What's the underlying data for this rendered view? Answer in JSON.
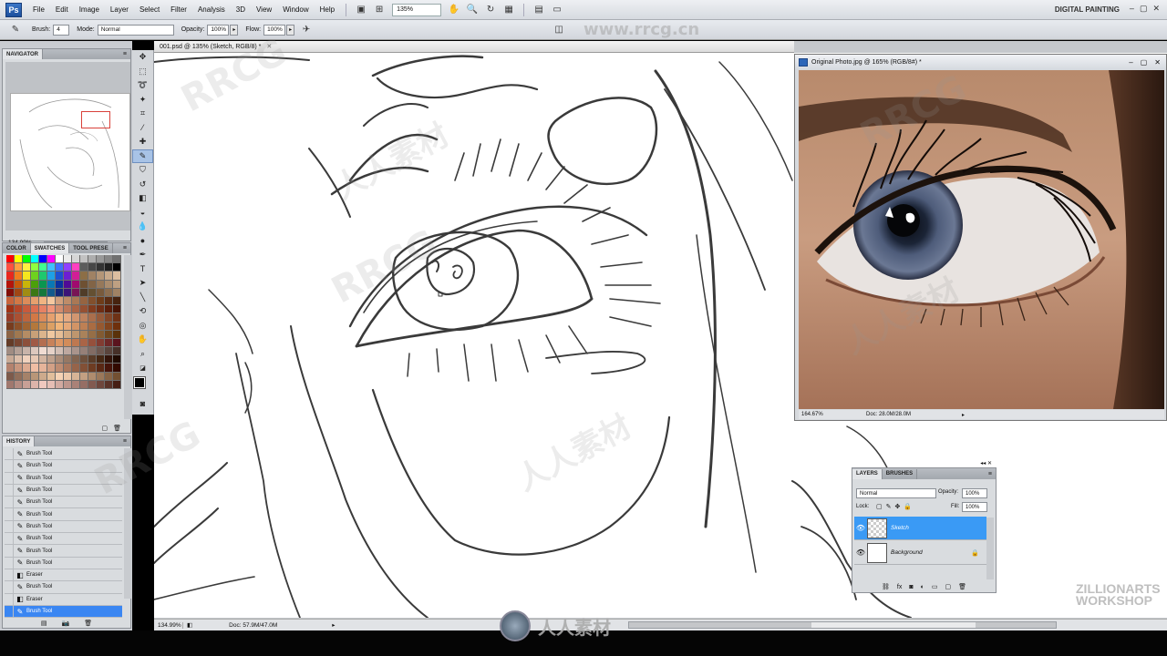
{
  "app": {
    "logo": "Ps",
    "menu": [
      "File",
      "Edit",
      "Image",
      "Layer",
      "Select",
      "Filter",
      "Analysis",
      "3D",
      "View",
      "Window",
      "Help"
    ],
    "zoom": "135%",
    "workspace": "DIGITAL PAINTING",
    "win_controls": [
      "–",
      "▢",
      "✕"
    ]
  },
  "options": {
    "brush_label": "Brush:",
    "brush_size": "4",
    "mode_label": "Mode:",
    "mode_value": "Normal",
    "opacity_label": "Opacity:",
    "opacity_value": "100%",
    "flow_label": "Flow:",
    "flow_value": "100%"
  },
  "document": {
    "tab_title": "001.psd @ 135% (Sketch, RGB/8) *",
    "status_zoom": "134.99%",
    "status_doc": "Doc: 57.9M/47.0M"
  },
  "navigator": {
    "title": "NAVIGATOR",
    "zoom": "134.99%"
  },
  "swatches": {
    "tabs": [
      "COLOR",
      "SWATCHES",
      "TOOL PRESE"
    ],
    "colors": [
      "#ff0000",
      "#ffff00",
      "#00ff00",
      "#00ffff",
      "#0000ff",
      "#ff00ff",
      "#ffffff",
      "#ebebeb",
      "#d6d6d6",
      "#c2c2c2",
      "#adadad",
      "#999999",
      "#858585",
      "#707070",
      "#ff5040",
      "#ffa040",
      "#fff040",
      "#90ff40",
      "#40ff90",
      "#40c0ff",
      "#4070ff",
      "#9040ff",
      "#ff40c0",
      "#5c5c5c",
      "#474747",
      "#333333",
      "#1f1f1f",
      "#000000",
      "#e8281e",
      "#f07d1e",
      "#f5e61e",
      "#6ed21e",
      "#1ec86e",
      "#1ea0e6",
      "#1e50d2",
      "#6e1ed2",
      "#d21e96",
      "#8c6e46",
      "#a08264",
      "#b49678",
      "#c8aa8c",
      "#dcbea0",
      "#b4140a",
      "#c85a0a",
      "#c8b40a",
      "#4ba00a",
      "#0a9650",
      "#0a78b4",
      "#0a32a0",
      "#500a96",
      "#a00a6e",
      "#6e5032",
      "#826446",
      "#96785a",
      "#aa8c6e",
      "#bea082",
      "#82100a",
      "#a04614",
      "#a08c14",
      "#3c7814",
      "#14783c",
      "#145a8c",
      "#142878",
      "#3c1478",
      "#781455",
      "#503c28",
      "#645032",
      "#785a3c",
      "#8c6e50",
      "#a08264",
      "#c8643c",
      "#d27846",
      "#dc8c5a",
      "#e6a06e",
      "#f0b482",
      "#f5c8a0",
      "#d2a07d",
      "#be8c69",
      "#aa7855",
      "#966441",
      "#82502d",
      "#6e3c19",
      "#5a2d14",
      "#46230f",
      "#a03214",
      "#b44628",
      "#c85a3c",
      "#dc6e50",
      "#e68264",
      "#f09678",
      "#d28c6e",
      "#be785a",
      "#aa6446",
      "#965032",
      "#823c1e",
      "#6e2d14",
      "#5a1e0a",
      "#461405",
      "#963c28",
      "#aa5032",
      "#be643c",
      "#d27846",
      "#dc8c5a",
      "#e6a06e",
      "#f0b482",
      "#e6aa82",
      "#d29670",
      "#be825e",
      "#aa6e4c",
      "#965a3a",
      "#824628",
      "#6e3216",
      "#783c1e",
      "#8c5028",
      "#a06432",
      "#b4783c",
      "#c88c50",
      "#dca064",
      "#f0b478",
      "#e6a878",
      "#d29466",
      "#be8054",
      "#aa6c42",
      "#965830",
      "#82441e",
      "#6e300c",
      "#8c6446",
      "#a07850",
      "#b48c64",
      "#c8a078",
      "#dcb48c",
      "#f0c8a0",
      "#e6be96",
      "#d2aa82",
      "#be966e",
      "#aa825a",
      "#966e46",
      "#825a32",
      "#6e461e",
      "#5a320a",
      "#643c28",
      "#784632",
      "#8c503c",
      "#a05a46",
      "#b46e50",
      "#c8825a",
      "#dc9664",
      "#d28c5a",
      "#be7850",
      "#aa6446",
      "#96503c",
      "#823c32",
      "#6e2828",
      "#5a141e",
      "#a08c82",
      "#b4a096",
      "#c8b4aa",
      "#dcc8be",
      "#f0dcd2",
      "#e6d2c8",
      "#d2beb4",
      "#bea8a0",
      "#aa948c",
      "#968078",
      "#826c64",
      "#6e5850",
      "#5a443c",
      "#463028",
      "#c8aa96",
      "#dcbeaa",
      "#f0d2be",
      "#e6c8b4",
      "#d2b4a0",
      "#bea08c",
      "#aa8c78",
      "#967864",
      "#826450",
      "#6e503c",
      "#5a3c28",
      "#462814",
      "#32140a",
      "#1e0a00",
      "#b4826e",
      "#c8967e",
      "#dcaa90",
      "#f0bea4",
      "#e6b49a",
      "#d2a086",
      "#be8c72",
      "#aa785e",
      "#96644a",
      "#825036",
      "#6e3c22",
      "#5a2814",
      "#46140a",
      "#320a00",
      "#7d5a4b",
      "#916e5a",
      "#a58269",
      "#b99678",
      "#cdaa8c",
      "#e1be9b",
      "#f5d2b4",
      "#ebc8aa",
      "#d7b496",
      "#c3a082",
      "#af8c6e",
      "#9b785a",
      "#876446",
      "#735032",
      "#a0786e",
      "#b48c82",
      "#c8a096",
      "#dcb4aa",
      "#f0c8be",
      "#e6beb4",
      "#d2aaa0",
      "#be968c",
      "#aa8278",
      "#966e64",
      "#825a50",
      "#6e463c",
      "#5a3228",
      "#461e14"
    ]
  },
  "history": {
    "title": "HISTORY",
    "items": [
      "Brush Tool",
      "Brush Tool",
      "Brush Tool",
      "Brush Tool",
      "Brush Tool",
      "Brush Tool",
      "Brush Tool",
      "Brush Tool",
      "Brush Tool",
      "Brush Tool",
      "Eraser",
      "Brush Tool",
      "Eraser",
      "Brush Tool"
    ]
  },
  "photo": {
    "title": "Original Photo.jpg @ 165% (RGB/8#) *",
    "zoom": "164.67%",
    "doc": "Doc: 28.0M/28.0M"
  },
  "layers": {
    "tabs": [
      "LAYERS",
      "BRUSHES"
    ],
    "blend": "Normal",
    "opacity_label": "Opacity:",
    "opacity": "100%",
    "lock_label": "Lock:",
    "fill_label": "Fill:",
    "fill": "100%",
    "items": [
      {
        "name": "Sketch",
        "selected": true
      },
      {
        "name": "Background",
        "selected": false
      }
    ]
  },
  "watermarks": {
    "rrcg": "RRCG",
    "chinese": "人人素材",
    "site": "www.rrcg.cn",
    "zillion_line1": "ZILLIONARTS",
    "zillion_line2": "WORKSHOP"
  }
}
